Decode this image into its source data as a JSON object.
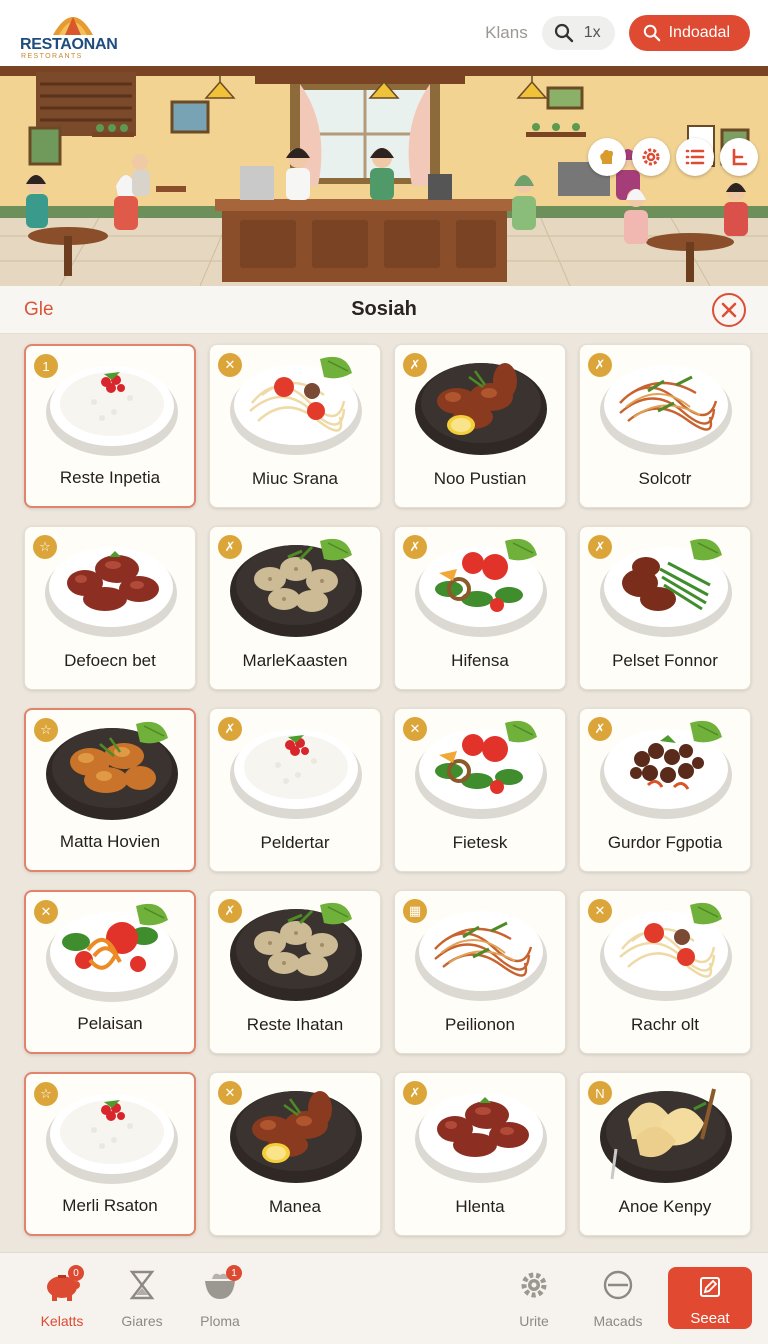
{
  "header": {
    "logo_word": "RESTAONAN",
    "logo_sub": "RESTORANTS",
    "link_label": "Klans",
    "zoom_label": "1x",
    "cta_label": "Indoadal"
  },
  "scene": {
    "tools": [
      "chef-hat-icon",
      "gear-icon",
      "list-icon",
      "exit-icon"
    ]
  },
  "panel": {
    "left_label": "Gle",
    "title": "Sosiah"
  },
  "menu_items": [
    {
      "name": "Reste Inpetia",
      "badge": "1",
      "dish": "rice",
      "selected": true
    },
    {
      "name": "Miuc Srana",
      "badge": "✕",
      "dish": "noodles-white",
      "selected": false
    },
    {
      "name": "Noo Pustian",
      "badge": "✗",
      "dish": "chicken",
      "selected": false
    },
    {
      "name": "Solcotr",
      "badge": "✗",
      "dish": "noodles-red",
      "selected": false
    },
    {
      "name": "Defoecn bet",
      "badge": "☆",
      "dish": "sausage",
      "selected": false
    },
    {
      "name": "MarleKaasten",
      "badge": "✗",
      "dish": "dumplings",
      "selected": false
    },
    {
      "name": "Hifensa",
      "badge": "✗",
      "dish": "salad",
      "selected": false
    },
    {
      "name": "Pelset Fonnor",
      "badge": "✗",
      "dish": "beef-greens",
      "selected": false
    },
    {
      "name": "Matta Hovien",
      "badge": "☆",
      "dish": "fried-chicken",
      "selected": true
    },
    {
      "name": "Peldertar",
      "badge": "✗",
      "dish": "rice",
      "selected": false
    },
    {
      "name": "Fietesk",
      "badge": "✕",
      "dish": "salad",
      "selected": false
    },
    {
      "name": "Gurdor Fgpotia",
      "badge": "✗",
      "dish": "beef-stew",
      "selected": false
    },
    {
      "name": "Pelaisan",
      "badge": "✕",
      "dish": "salad-red",
      "selected": true
    },
    {
      "name": "Reste Ihatan",
      "badge": "✗",
      "dish": "dumplings",
      "selected": false
    },
    {
      "name": "Peilionon",
      "badge": "▦",
      "dish": "noodles-red",
      "selected": false
    },
    {
      "name": "Rachr olt",
      "badge": "✕",
      "dish": "noodles-white",
      "selected": false
    },
    {
      "name": "Merli Rsaton",
      "badge": "☆",
      "dish": "rice",
      "selected": true
    },
    {
      "name": "Manea",
      "badge": "✕",
      "dish": "chicken",
      "selected": false
    },
    {
      "name": "Hlenta",
      "badge": "✗",
      "dish": "sausage",
      "selected": false
    },
    {
      "name": "Anoe Kenpy",
      "badge": "N",
      "dish": "dumplings-pan",
      "selected": false
    }
  ],
  "bottom_nav": [
    {
      "label": "Kelatts",
      "icon": "piggy-bank-icon",
      "badge": "0",
      "active": true
    },
    {
      "label": "Giares",
      "icon": "hourglass-icon",
      "badge": "",
      "active": false
    },
    {
      "label": "Ploma",
      "icon": "bowl-icon",
      "badge": "1",
      "active": false
    },
    {
      "label": "Urite",
      "icon": "gear-icon",
      "badge": "",
      "active": false
    },
    {
      "label": "Macads",
      "icon": "minus-circle-icon",
      "badge": "",
      "active": false
    }
  ],
  "seat_button": {
    "label": "Seeat",
    "icon": "edit-icon"
  },
  "colors": {
    "accent": "#df4a32",
    "badge": "#dba53a",
    "wall": "#f2d392",
    "wood": "#8a4f2a"
  }
}
